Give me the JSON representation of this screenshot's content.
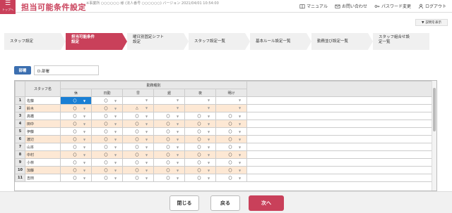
{
  "header": {
    "home_label": "トップへ",
    "title": "担当可能条件設定",
    "breadcrumb": "※事業所 ○○○○○○ 様 (法人番号 ○○○○○○) バージョン 2021/04/01 10:54:00",
    "links": {
      "manual": "マニュアル",
      "contact": "お問い合わせ",
      "password": "パスワード変更",
      "logout": "ログアウト"
    }
  },
  "desc_button": "説明を表示",
  "steps": [
    {
      "line1": "スタッフ設定",
      "line2": ""
    },
    {
      "line1": "担当可能条件",
      "line2": "設定"
    },
    {
      "line1": "曜日別固定シフト",
      "line2": "設定"
    },
    {
      "line1": "スタッフ設定一覧",
      "line2": ""
    },
    {
      "line1": "基本ルール設定一覧",
      "line2": ""
    },
    {
      "line1": "勤務並び設定一覧",
      "line2": ""
    },
    {
      "line1": "スタッフ組合せ設",
      "line2": "定一覧"
    }
  ],
  "dept": {
    "label": "部署",
    "value": "D.部署"
  },
  "grid": {
    "group_header": "勤務種別",
    "staff_header": "スタッフ名",
    "columns": [
      "休",
      "日勤",
      "早",
      "遅",
      "夜",
      "明け"
    ],
    "rows": [
      {
        "n": "1",
        "name": "佐藤",
        "vals": [
          "〇",
          "〇",
          "",
          "",
          "",
          ""
        ]
      },
      {
        "n": "2",
        "name": "鈴木",
        "vals": [
          "〇",
          "〇",
          "△",
          "",
          "",
          ""
        ]
      },
      {
        "n": "3",
        "name": "高橋",
        "vals": [
          "〇",
          "〇",
          "〇",
          "〇",
          "〇",
          "〇"
        ]
      },
      {
        "n": "4",
        "name": "田中",
        "vals": [
          "〇",
          "〇",
          "〇",
          "〇",
          "〇",
          "〇"
        ]
      },
      {
        "n": "5",
        "name": "伊藤",
        "vals": [
          "〇",
          "〇",
          "〇",
          "〇",
          "〇",
          "〇"
        ]
      },
      {
        "n": "6",
        "name": "渡辺",
        "vals": [
          "〇",
          "〇",
          "〇",
          "〇",
          "〇",
          "〇"
        ]
      },
      {
        "n": "7",
        "name": "山本",
        "vals": [
          "〇",
          "〇",
          "〇",
          "〇",
          "〇",
          "〇"
        ]
      },
      {
        "n": "8",
        "name": "中村",
        "vals": [
          "〇",
          "〇",
          "〇",
          "〇",
          "〇",
          "〇"
        ]
      },
      {
        "n": "9",
        "name": "小林",
        "vals": [
          "〇",
          "〇",
          "〇",
          "〇",
          "〇",
          "〇"
        ]
      },
      {
        "n": "10",
        "name": "加藤",
        "vals": [
          "〇",
          "〇",
          "〇",
          "〇",
          "〇",
          "〇"
        ]
      },
      {
        "n": "11",
        "name": "吉田",
        "vals": [
          "〇",
          "〇",
          "〇",
          "〇",
          "〇",
          "〇"
        ]
      }
    ]
  },
  "footer": {
    "close": "閉じる",
    "back": "戻る",
    "next": "次へ"
  },
  "colors": {
    "brand": "#c9405a",
    "dept_badge": "#3c6fb0",
    "selected": "#1a7fd4",
    "alt_row": "#fde8d4"
  }
}
